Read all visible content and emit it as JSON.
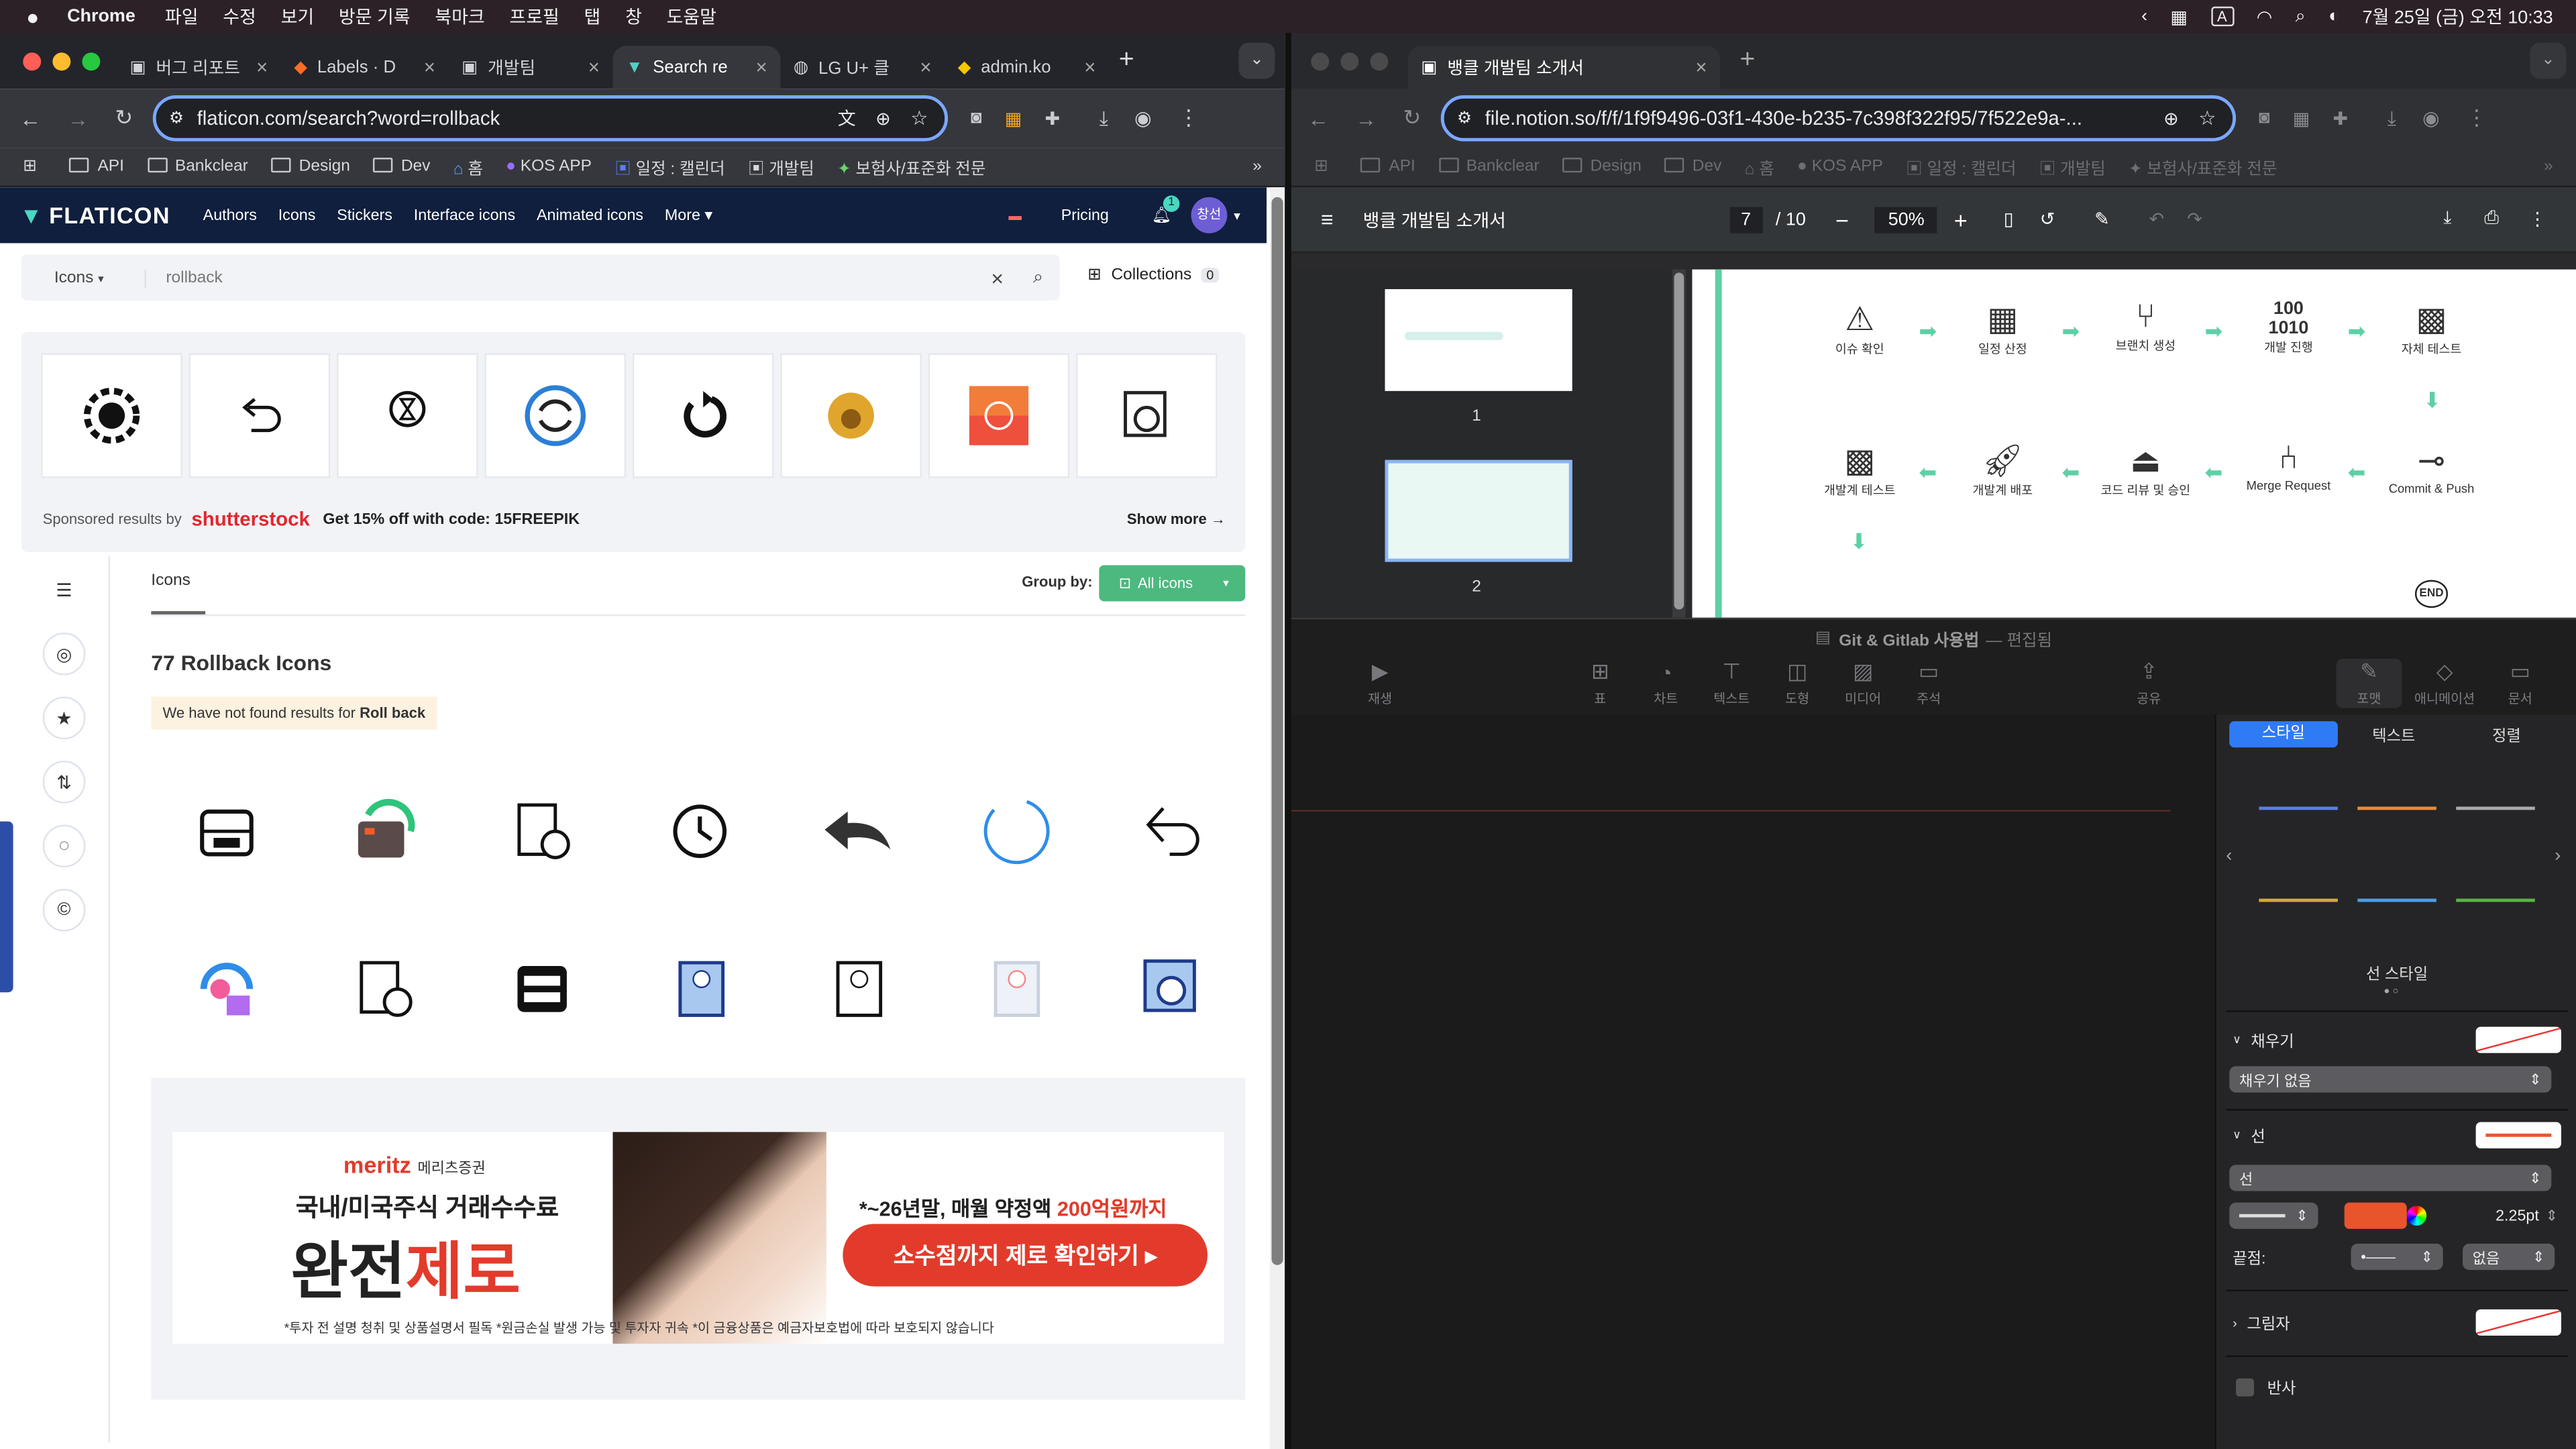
{
  "menubar": {
    "app": "Chrome",
    "items": [
      "파일",
      "수정",
      "보기",
      "방문 기록",
      "북마크",
      "프로필",
      "탭",
      "창",
      "도움말"
    ],
    "clock": "7월 25일 (금) 오전 10:33",
    "input_badge": "A"
  },
  "left": {
    "tabs": [
      "버그 리포트",
      "Labels · D",
      "개발팀",
      "Search re",
      "LG U+ 클",
      "admin.ko"
    ],
    "url": "flaticon.com/search?word=rollback",
    "bookmarks": [
      "API",
      "Bankclear",
      "Design",
      "Dev",
      "홈",
      "KOS APP",
      "일정 : 캘린더",
      "개발팀",
      "보험사/표준화 전문"
    ],
    "brand": "FLATICON",
    "nav": [
      "Authors",
      "Icons",
      "Stickers",
      "Interface icons",
      "Animated icons",
      "More"
    ],
    "pricing": "Pricing",
    "notif_count": "1",
    "avatar": "창선",
    "search_type": "Icons",
    "search_query": "rollback",
    "collections": "Collections",
    "collections_count": "0",
    "sponsored": "Sponsored results by",
    "shutterstock": "shutterstock",
    "promo": "Get 15% off with code: 15FREEPIK",
    "show_more": "Show more",
    "tab_icons": "Icons",
    "group_by": "Group by:",
    "all_icons": "All icons",
    "heading": "77 Rollback Icons",
    "notice_prefix": "We have not found results for ",
    "notice_term": "Roll back",
    "ad": {
      "brand": "meritz",
      "brand_ko": "메리츠증권",
      "line1": "국내/미국주식 거래수수료",
      "line2a": "완전",
      "line2b": "제로",
      "offer_prefix": "*~26년말, 매월 약정액 ",
      "offer_highlight": "200억원까지",
      "cta": "소수점까지 제로 확인하기 ▸",
      "disclaimer": "*투자 전 설명 청취 및 상품설명서 필독 *원금손실 발생 가능 및 투자자 귀속 *이 금융상품은 예금자보호법에 따라 보호되지 않습니다"
    }
  },
  "right": {
    "tab": "뱅클 개발팀 소개서",
    "url": "file.notion.so/f/f/1f9f9496-03f1-430e-b235-7c398f322f95/7f522e9a-...",
    "pdf_title": "뱅클 개발팀 소개서",
    "page_current": "7",
    "page_total": "/ 10",
    "zoom": "50%",
    "pages": [
      "1",
      "2"
    ],
    "flow_row1": [
      "이슈 확인",
      "일정 산정",
      "브랜치 생성",
      "개발 진행",
      "자체 테스트"
    ],
    "flow_row2": [
      "개발계 테스트",
      "개발계 배포",
      "코드 리뷰 및 승인",
      "Merge Request",
      "Commit & Push"
    ],
    "flow_row3_end": "END",
    "keynote": {
      "title": "Git & Gitlab 사용법",
      "status": "— 편집됨",
      "tools": [
        "재생",
        "표",
        "차트",
        "텍스트",
        "도형",
        "미디어",
        "주석",
        "공유",
        "포맷",
        "애니메이션",
        "문서"
      ],
      "tabs": [
        "스타일",
        "텍스트",
        "정렬"
      ],
      "line_style_label": "선 스타일",
      "fill": "채우기",
      "fill_value": "채우기 없음",
      "stroke": "선",
      "stroke_value": "선",
      "width": "2.25pt",
      "endpoints": "끝점:",
      "end_value": "없음",
      "shadow": "그림자",
      "reflection": "반사",
      "colors": {
        "accent": "#2f7bf6",
        "stroke": "#e8552c"
      }
    }
  }
}
